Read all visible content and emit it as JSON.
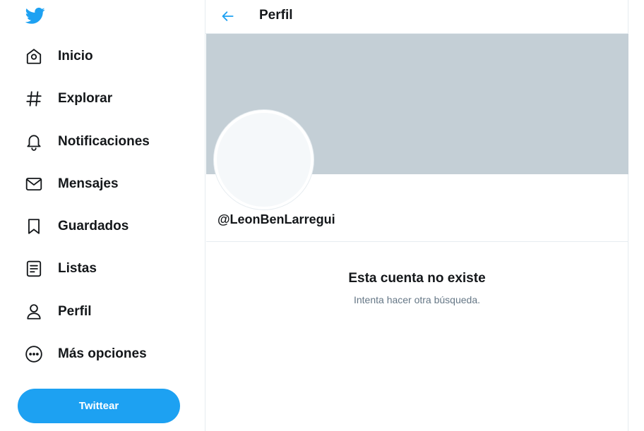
{
  "sidebar": {
    "logo_icon": "twitter-bird-icon",
    "items": [
      {
        "label": "Inicio",
        "icon": "home-icon"
      },
      {
        "label": "Explorar",
        "icon": "hashtag-icon"
      },
      {
        "label": "Notificaciones",
        "icon": "bell-icon"
      },
      {
        "label": "Mensajes",
        "icon": "envelope-icon"
      },
      {
        "label": "Guardados",
        "icon": "bookmark-icon"
      },
      {
        "label": "Listas",
        "icon": "list-icon"
      },
      {
        "label": "Perfil",
        "icon": "person-icon"
      },
      {
        "label": "Más opciones",
        "icon": "more-circle-icon"
      }
    ],
    "tweet_button": "Twittear"
  },
  "header": {
    "back_icon": "back-arrow-icon",
    "title": "Perfil"
  },
  "profile": {
    "handle": "@LeonBenLarregui"
  },
  "empty_state": {
    "title": "Esta cuenta no existe",
    "subtitle": "Intenta hacer otra búsqueda."
  },
  "colors": {
    "brand": "#1da1f2",
    "banner": "#c4cfd6",
    "text": "#14171a",
    "muted": "#657786"
  }
}
